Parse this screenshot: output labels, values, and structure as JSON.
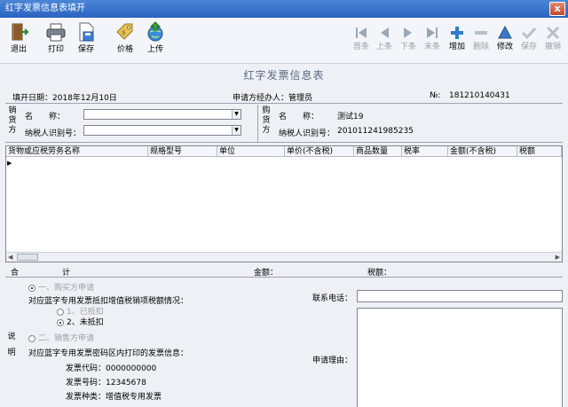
{
  "window": {
    "title": "红字发票信息表填开",
    "close_label": "x"
  },
  "toolbar": {
    "exit": "退出",
    "print": "打印",
    "save": "保存",
    "price": "价格",
    "upload": "上传",
    "first": "首条",
    "prev": "上条",
    "next": "下条",
    "last": "末条",
    "add": "增加",
    "delete": "删除",
    "edit": "修改",
    "save2": "保存",
    "cancel": "撤销"
  },
  "form": {
    "title": "红字发票信息表",
    "fill_date": "填开日期：2018年12月10日",
    "applicant": "申请方经办人：管理员",
    "no_label": "№:",
    "no_value": "181210140431"
  },
  "seller": {
    "side_label": "销货方",
    "name_label": "名　　称：",
    "tax_label": "纳税人识别号："
  },
  "buyer": {
    "side_label": "购货方",
    "name_label": "名　　称：",
    "name_value": "测试19",
    "tax_label": "纳税人识别号：",
    "tax_value": "201011241985235"
  },
  "table": {
    "headers": [
      "货物或应税劳务名称",
      "规格型号",
      "单位",
      "单价(不含税)",
      "商品数量",
      "税率",
      "金额(不含税)",
      "税额"
    ]
  },
  "totals": {
    "he": "合",
    "ji": "计",
    "amount_label": "金额：",
    "tax_label": "税额："
  },
  "explanation": {
    "side_label": "说明",
    "opt1": "一、购买方申请",
    "deduct_question": "对应蓝字专用发票抵扣增值税销项税额情况：",
    "opt1a": "1、已抵扣",
    "opt1b": "2、未抵扣",
    "opt2": "二、销售方申请",
    "invoice_info": "对应蓝字专用发票密码区内打印的发票信息：",
    "code": "发票代码：0000000000",
    "number": "发票号码：12345678",
    "kind": "发票种类：增值税专用发票",
    "phone_label": "联系电话：",
    "reason_label": "申请理由："
  }
}
